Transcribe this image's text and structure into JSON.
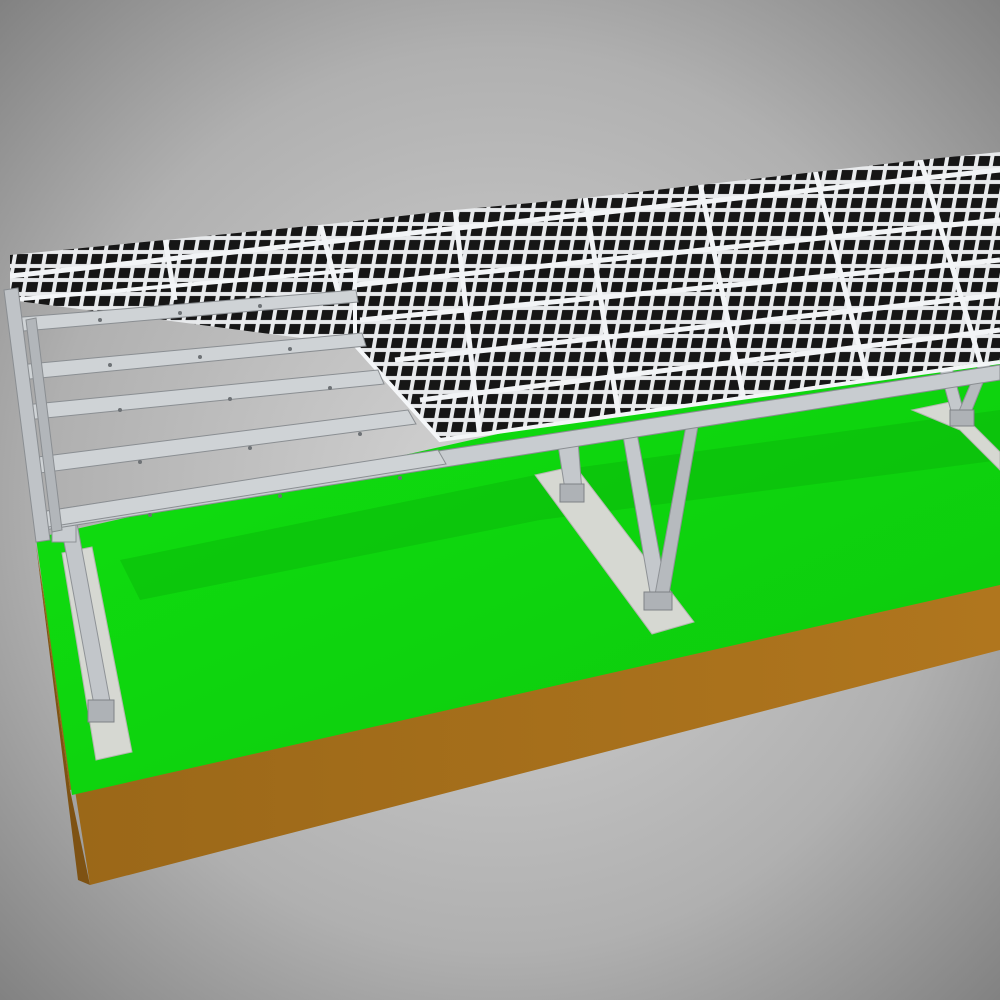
{
  "scene": {
    "subject": "solar-carport-mounting-structure",
    "colors": {
      "background_light": "#d2d2d2",
      "background_dark": "#7c7c7c",
      "grass": "#12e312",
      "soil": "#a8701c",
      "soil_dark": "#8c5c16",
      "footing": "#d4d6d0",
      "steel": "#c4c8cc",
      "steel_dark": "#8e9296",
      "panel_frame": "#e6e8ea",
      "panel_cell": "#1a1a1a"
    }
  }
}
